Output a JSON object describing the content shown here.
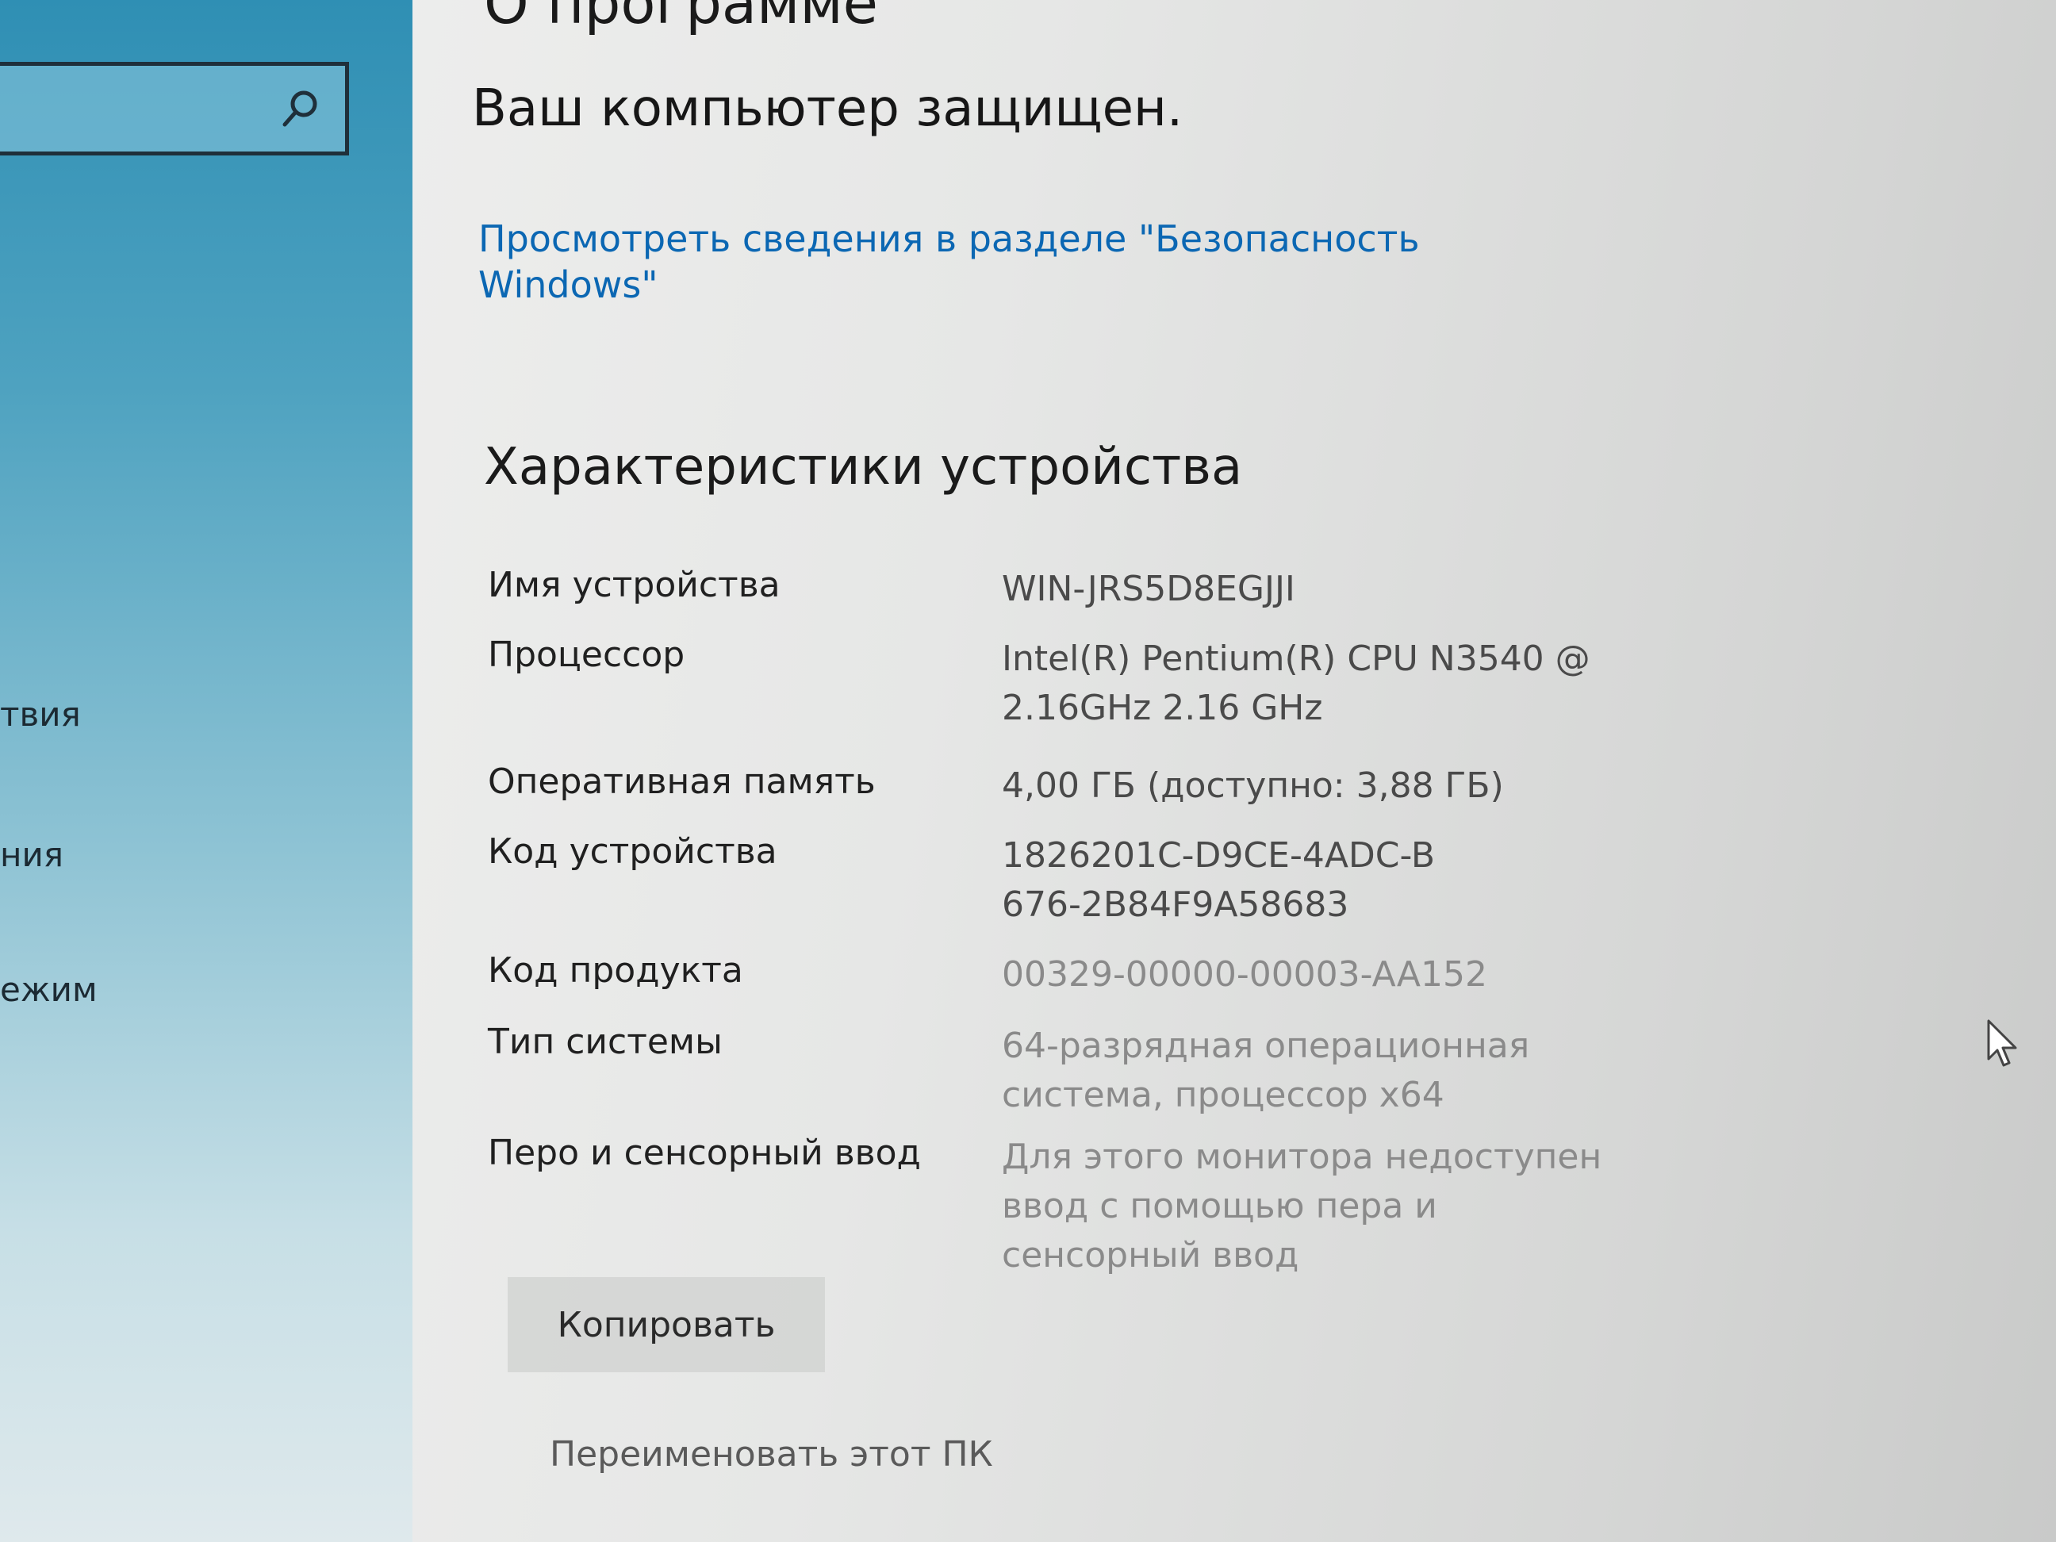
{
  "sidebar": {
    "items": [
      {
        "label": "твия"
      },
      {
        "label": "ния"
      },
      {
        "label": "ежим"
      }
    ]
  },
  "header": {
    "partial_title": "О программе"
  },
  "security": {
    "status": "Ваш компьютер защищен.",
    "link": "Просмотреть сведения в разделе \"Безопасность Windows\""
  },
  "device_specs": {
    "title": "Характеристики устройства",
    "rows": [
      {
        "label": "Имя устройства",
        "value": "WIN-JRS5D8EGJJI"
      },
      {
        "label": "Процессор",
        "value": "Intel(R) Pentium(R) CPU  N3540  @ 2.16GHz   2.16 GHz"
      },
      {
        "label": "Оперативная память",
        "value": "4,00 ГБ (доступно: 3,88 ГБ)"
      },
      {
        "label": "Код устройства",
        "value": "1826201C-D9CE-4ADC-B676-2B84F9A58683"
      },
      {
        "label": "Код продукта",
        "value": "00329-00000-00003-AA152"
      },
      {
        "label": "Тип системы",
        "value": "64-разрядная операционная система, процессор x64"
      },
      {
        "label": "Перо и сенсорный ввод",
        "value": "Для этого монитора недоступен ввод с помощью пера и сенсорный ввод"
      }
    ],
    "copy_label": "Копировать",
    "rename_label": "Переименовать этот ПК"
  },
  "icons": {
    "search": "search-icon",
    "cursor": "mouse-cursor-icon"
  },
  "colors": {
    "link": "#0b67b3",
    "sidebar_accent": "#2f8fb4"
  }
}
